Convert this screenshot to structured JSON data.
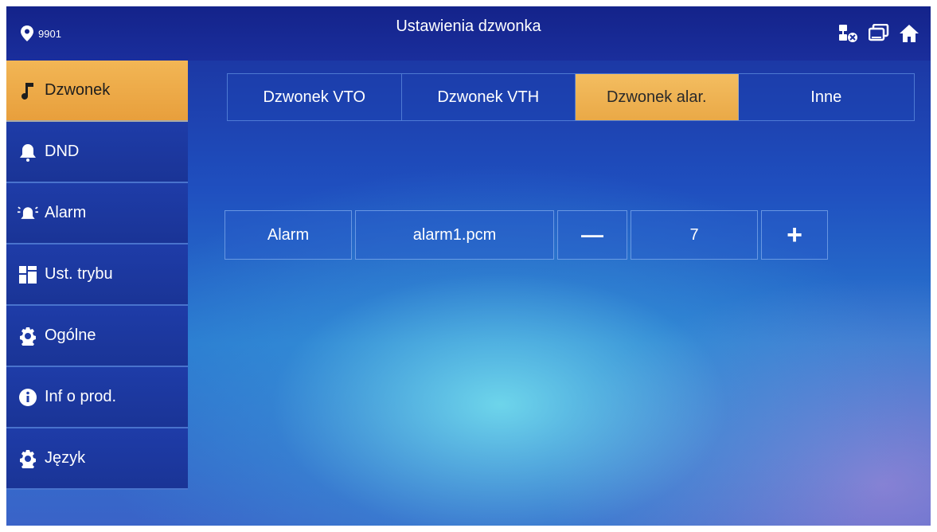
{
  "header": {
    "site_id": "9901",
    "title": "Ustawienia dzwonka"
  },
  "sidebar": {
    "items": [
      {
        "label": "Dzwonek",
        "icon": "music-note-icon",
        "active": true
      },
      {
        "label": "DND",
        "icon": "bell-icon",
        "active": false
      },
      {
        "label": "Alarm",
        "icon": "alarm-icon",
        "active": false
      },
      {
        "label": "Ust. trybu",
        "icon": "grid-icon",
        "active": false
      },
      {
        "label": "Ogólne",
        "icon": "gear-icon",
        "active": false
      },
      {
        "label": "Inf o prod.",
        "icon": "info-icon",
        "active": false
      },
      {
        "label": "Język",
        "icon": "gear-icon",
        "active": false
      }
    ]
  },
  "tabs": [
    {
      "label": "Dzwonek VTO",
      "active": false
    },
    {
      "label": "Dzwonek VTH",
      "active": false
    },
    {
      "label": "Dzwonek alar.",
      "active": true
    },
    {
      "label": "Inne",
      "active": false
    }
  ],
  "alarm_row": {
    "label": "Alarm",
    "file": "alarm1.pcm",
    "minus": "—",
    "volume": "7",
    "plus": "+"
  },
  "colors": {
    "accent": "#eea848",
    "header": "#14238a",
    "sidebar": "#1e3ca8"
  }
}
